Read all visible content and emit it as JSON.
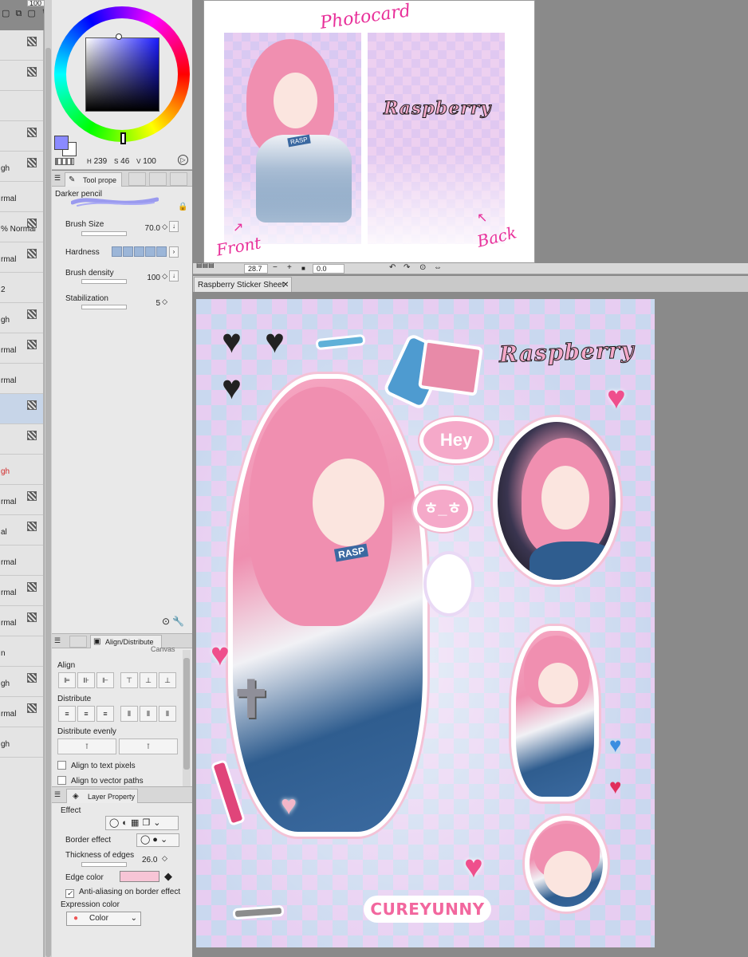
{
  "top_toolbar": {
    "value": "100"
  },
  "layer_panel": {
    "rows": [
      {
        "label": "",
        "selected": false
      },
      {
        "label": "",
        "selected": false
      },
      {
        "label": "",
        "selected": false
      },
      {
        "label": "",
        "selected": false
      },
      {
        "label": "gh",
        "selected": false
      },
      {
        "label": "rmal",
        "selected": false
      },
      {
        "label": "% Normal",
        "selected": false
      },
      {
        "label": "rmal",
        "selected": false
      },
      {
        "label": "2",
        "selected": false
      },
      {
        "label": "gh",
        "selected": false
      },
      {
        "label": "rmal",
        "selected": false
      },
      {
        "label": "rmal",
        "selected": false
      },
      {
        "label": "",
        "selected": true
      },
      {
        "label": "",
        "selected": false
      },
      {
        "label": "gh",
        "selected": false,
        "red": true
      },
      {
        "label": "rmal",
        "selected": false
      },
      {
        "label": "al",
        "selected": false
      },
      {
        "label": "rmal",
        "selected": false
      },
      {
        "label": "rmal",
        "selected": false
      },
      {
        "label": "rmal",
        "selected": false
      },
      {
        "label": "n",
        "selected": false
      },
      {
        "label": "gh",
        "selected": false
      },
      {
        "label": "rmal",
        "selected": false
      },
      {
        "label": "gh",
        "selected": false
      }
    ]
  },
  "color_panel": {
    "main_color": "#8a8aff",
    "sub_color": "#ffffff",
    "h": "239",
    "s": "46",
    "v": "100",
    "h_label": "H",
    "s_label": "S",
    "v_label": "V"
  },
  "tool_property": {
    "tab_label": "Tool prope",
    "brush_name": "Darker pencil",
    "brush_size_label": "Brush Size",
    "brush_size_value": "70.0",
    "hardness_label": "Hardness",
    "brush_density_label": "Brush density",
    "brush_density_value": "100",
    "stabilization_label": "Stabilization",
    "stabilization_value": "5"
  },
  "align_panel": {
    "tab_label": "Align/Distribute",
    "canvas_label": "Canvas",
    "align_label": "Align",
    "distribute_label": "Distribute",
    "distribute_evenly_label": "Distribute evenly",
    "align_text_pixels": "Align to text pixels",
    "align_vector_paths": "Align to vector paths"
  },
  "layer_property": {
    "tab_label": "Layer Property",
    "effect_label": "Effect",
    "border_effect_label": "Border effect",
    "thickness_label": "Thickness of edges",
    "thickness_value": "26.0",
    "edge_color_label": "Edge color",
    "edge_color": "#f7c5d6",
    "antialias_label": "Anti-aliasing on border effect",
    "expression_color_label": "Expression color",
    "expression_color_value": "Color"
  },
  "photocard": {
    "title": "Photocard",
    "logo": "Raspberry",
    "front_label": "Front",
    "back_label": "Back"
  },
  "nav_bar": {
    "zoom": "28.7",
    "rotation": "0.0"
  },
  "sticker_sheet": {
    "tab_title": "Raspberry Sticker Sheet",
    "logo": "Raspberry",
    "bubble_hey": "Hey",
    "bubble_face": "ㅎ_ㅎ",
    "brand": "CUREYUNNY",
    "badge_rasp": "RASP"
  }
}
